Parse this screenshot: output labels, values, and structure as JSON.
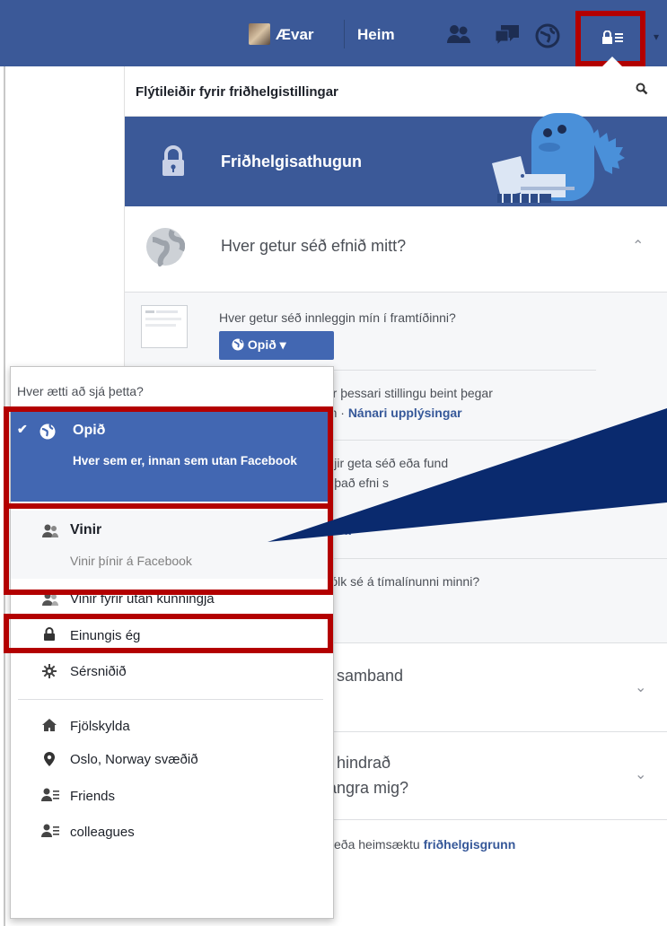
{
  "topbar": {
    "user_name": "Ævar",
    "home_label": "Heim",
    "icons": [
      "friend-requests-icon",
      "messages-icon",
      "notifications-icon",
      "privacy-shortcuts-icon"
    ]
  },
  "panel": {
    "title": "Flýtileiðir fyrir friðhelgistillingar",
    "checkup_label": "Friðhelgisathugun",
    "section1_title": "Hver getur séð efnið mitt?",
    "future_posts_question": "Hver getur séð innleggin mín í framtíðinni?",
    "open_button_label": "Opið",
    "text1a": "eyttir þessari stillingu beint þegar",
    "text1b": "ð inn ·",
    "learn_more": "Nánari upplýsingar",
    "text2a": "hverjir geta séð eða fund",
    "text2b": "eða það efni s",
    "text2c": "a",
    "text3": "að fólk sé á tímalínunni minni?",
    "section2_text": "aft samband",
    "section3_line1": "ég hindrað",
    "section3_line2": "ð angra mig?",
    "footer_text": "r eða heimsæktu",
    "footer_link": "friðhelgisgrunn"
  },
  "menu": {
    "header": "Hver ætti að sjá þetta?",
    "open_title": "Opið",
    "open_desc": "Hver sem er, innan sem utan Facebook",
    "friends_title": "Vinir",
    "friends_desc": "Vinir þínir á Facebook",
    "items": {
      "friends_except": "Vinir fyrir utan kunningja",
      "only_me": "Einungis ég",
      "custom": "Sérsniðið",
      "family": "Fjölskylda",
      "oslo": "Oslo, Norway svæðið",
      "friends_list": "Friends",
      "colleagues": "colleagues"
    }
  },
  "colors": {
    "brand": "#3b5998",
    "highlight": "#b30000",
    "arrow": "#0a2a6e"
  }
}
